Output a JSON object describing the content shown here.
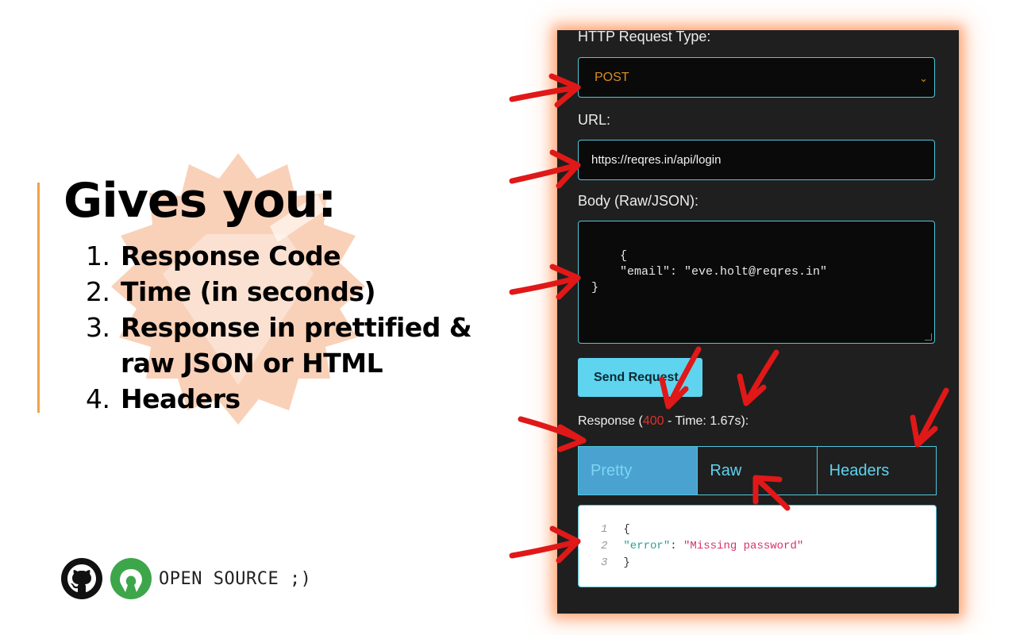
{
  "slide": {
    "headline": "Gives you:",
    "features": [
      {
        "num": "1.",
        "text": "Response Code"
      },
      {
        "num": "2.",
        "text": "Time (in seconds)"
      },
      {
        "num": "3.",
        "text": "Response in prettified &"
      },
      {
        "num": "",
        "text": "raw JSON or HTML"
      },
      {
        "num": "4.",
        "text": "Headers"
      }
    ],
    "footer_text": "OPEN SOURCE ;)",
    "icons": [
      "github-icon",
      "open-source-icon"
    ],
    "colors": {
      "accent": "#f0a24a",
      "arrow": "#e01818",
      "seal": "#f3b08a"
    }
  },
  "app": {
    "request_type_label": "HTTP Request Type:",
    "request_type_value": "POST",
    "url_label": "URL:",
    "url_value": "https://reqres.in/api/login",
    "body_label": "Body (Raw/JSON):",
    "body_value": "{\n    \"email\": \"eve.holt@reqres.in\"\n}",
    "send_label": "Send Request",
    "response_prefix": "Response (",
    "response_code": "400",
    "response_suffix": " - Time: 1.67s):",
    "tabs": [
      "Pretty",
      "Raw",
      "Headers"
    ],
    "active_tab": "Pretty",
    "output_lines": [
      {
        "n": "1",
        "text": "{"
      },
      {
        "n": "2",
        "key": "\"error\"",
        "sep": ": ",
        "value": "\"Missing password\""
      },
      {
        "n": "3",
        "text": "}"
      }
    ],
    "colors": {
      "panel": "#1f1f1f",
      "border": "#4fc6dc",
      "button": "#5ed4ef",
      "method": "#d98c2a",
      "status_code": "#e0302b"
    }
  }
}
